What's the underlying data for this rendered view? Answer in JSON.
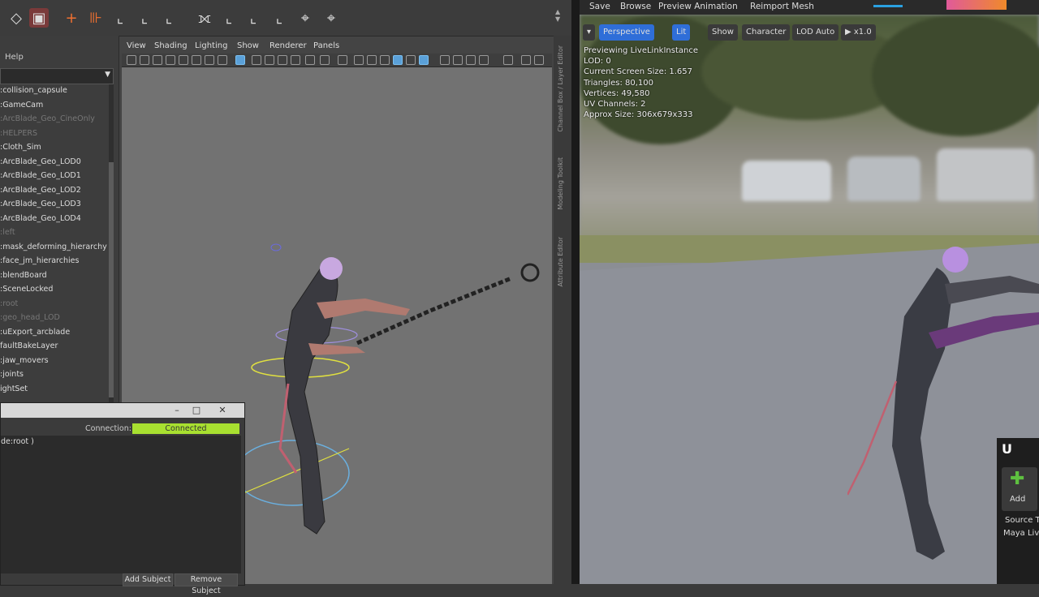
{
  "maya": {
    "outliner": {
      "menu_help": "Help",
      "items": [
        {
          "label": ":collision_capsule",
          "dim": false
        },
        {
          "label": ":GameCam",
          "dim": false
        },
        {
          "label": ":ArcBlade_Geo_CineOnly",
          "dim": true
        },
        {
          "label": ":HELPERS",
          "dim": true
        },
        {
          "label": ":Cloth_Sim",
          "dim": false
        },
        {
          "label": ":ArcBlade_Geo_LOD0",
          "dim": false
        },
        {
          "label": ":ArcBlade_Geo_LOD1",
          "dim": false
        },
        {
          "label": ":ArcBlade_Geo_LOD2",
          "dim": false
        },
        {
          "label": ":ArcBlade_Geo_LOD3",
          "dim": false
        },
        {
          "label": ":ArcBlade_Geo_LOD4",
          "dim": false
        },
        {
          "label": ":left",
          "dim": true
        },
        {
          "label": ":mask_deforming_hierarchy",
          "dim": false
        },
        {
          "label": ":face_jm_hierarchies",
          "dim": false
        },
        {
          "label": ":blendBoard",
          "dim": false
        },
        {
          "label": ":SceneLocked",
          "dim": false
        },
        {
          "label": ":root",
          "dim": true
        },
        {
          "label": ":geo_head_LOD",
          "dim": true
        },
        {
          "label": ":uExport_arcblade",
          "dim": false
        },
        {
          "label": "faultBakeLayer",
          "dim": false
        },
        {
          "label": ":jaw_movers",
          "dim": false
        },
        {
          "label": ":joints",
          "dim": false
        },
        {
          "label": "ightSet",
          "dim": false
        }
      ]
    },
    "viewport_menu": [
      "View",
      "Shading",
      "Lighting",
      "Show",
      "Renderer",
      "Panels"
    ],
    "side_tabs": [
      "Channel Box / Layer Editor",
      "Modeling Toolkit",
      "Attribute Editor"
    ],
    "livelink": {
      "connection_label": "Connection:",
      "connection_status": "Connected",
      "connection_color": "#a8e030",
      "subject": "de:root )",
      "add_subject": "Add Subject",
      "remove_subject": "Remove Subject"
    }
  },
  "unreal": {
    "toolbar": [
      "Save",
      "Browse",
      "Preview Animation",
      "Reimport Mesh"
    ],
    "viewport_buttons": {
      "perspective": "Perspective",
      "lit": "Lit",
      "show": "Show",
      "character": "Character",
      "lod": "LOD Auto",
      "speed": "x1.0"
    },
    "stats": [
      "Previewing LiveLinkInstance",
      "LOD: 0",
      "Current Screen Size: 1.657",
      "Triangles: 80,100",
      "Vertices: 49,580",
      "UV Channels: 2",
      "Approx Size: 306x679x333"
    ],
    "panel": {
      "add_label": "Add",
      "source_label": "Source T",
      "source_value": "Maya Liv"
    }
  }
}
